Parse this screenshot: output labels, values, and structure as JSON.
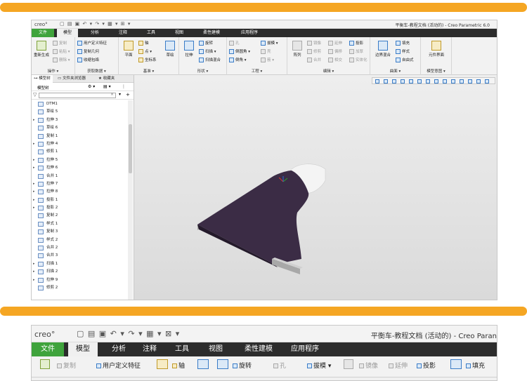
{
  "colors": {
    "accent_bar": "#f5a623",
    "file_tab": "#3fa33c",
    "tab_bar": "#2c2c2c",
    "model_fill": "#3b2c45"
  },
  "top_window": {
    "app_logo": "creo°",
    "title": "平衡车-教程文档 (活动的) - Creo Parametric 6.0",
    "tabs": [
      "文件",
      "模型",
      "分析",
      "注释",
      "工具",
      "视图",
      "柔性建模",
      "应用程序"
    ],
    "active_tab": "模型",
    "ribbon": {
      "groups": [
        {
          "caption": "操作 ▾",
          "items": [
            "重新生成",
            "复制",
            "粘贴 ▾",
            "删除 ▾"
          ]
        },
        {
          "caption": "获取数据 ▾",
          "items": [
            "用户定义特征",
            "复制几何",
            "收缩包络"
          ]
        },
        {
          "caption": "基准 ▾",
          "items": [
            "平面",
            "轴",
            "点 ▾",
            "坐标系",
            "草绘"
          ]
        },
        {
          "caption": "形状 ▾",
          "items": [
            "拉伸",
            "旋转",
            "扫描 ▾",
            "扫描混合"
          ]
        },
        {
          "caption": "工程 ▾",
          "items": [
            "孔",
            "倒圆角 ▾",
            "倒角 ▾",
            "拔模 ▾",
            "壳",
            "筋 ▾"
          ]
        },
        {
          "caption": "编辑 ▾",
          "items": [
            "阵列",
            "镜像",
            "修剪",
            "合并",
            "延伸",
            "偏移",
            "相交",
            "投影",
            "加厚",
            "实体化"
          ]
        },
        {
          "caption": "曲面 ▾",
          "items": [
            "边界混合",
            "填充",
            "样式",
            "自由式"
          ]
        },
        {
          "caption": "模型意图 ▾",
          "items": [
            "元件界面"
          ]
        }
      ]
    },
    "left_panel": {
      "tabs": [
        "模型树",
        "文件夹浏览器",
        "收藏夹"
      ],
      "header": "模型树",
      "tree_items": [
        {
          "label": "DTM1",
          "expandable": false
        },
        {
          "label": "草绘 5",
          "expandable": false
        },
        {
          "label": "拉伸 3",
          "expandable": true
        },
        {
          "label": "草绘 6",
          "expandable": false
        },
        {
          "label": "复制 1",
          "expandable": false
        },
        {
          "label": "拉伸 4",
          "expandable": true
        },
        {
          "label": "修剪 1",
          "expandable": false
        },
        {
          "label": "拉伸 5",
          "expandable": true
        },
        {
          "label": "拉伸 6",
          "expandable": true
        },
        {
          "label": "合并 1",
          "expandable": false
        },
        {
          "label": "拉伸 7",
          "expandable": true
        },
        {
          "label": "拉伸 8",
          "expandable": true
        },
        {
          "label": "投影 1",
          "expandable": true
        },
        {
          "label": "投影 2",
          "expandable": true
        },
        {
          "label": "复制 2",
          "expandable": false
        },
        {
          "label": "样式 1",
          "expandable": false
        },
        {
          "label": "复制 3",
          "expandable": false
        },
        {
          "label": "样式 2",
          "expandable": false
        },
        {
          "label": "合并 2",
          "expandable": false
        },
        {
          "label": "合并 3",
          "expandable": false
        },
        {
          "label": "扫描 1",
          "expandable": true
        },
        {
          "label": "扫描 2",
          "expandable": true
        },
        {
          "label": "拉伸 9",
          "expandable": true
        },
        {
          "label": "修剪 2",
          "expandable": false
        }
      ]
    }
  },
  "bottom_window": {
    "app_logo": "creo°",
    "title": "平衡车-教程文档 (活动的) - Creo Paran",
    "tabs": [
      "文件",
      "模型",
      "分析",
      "注释",
      "工具",
      "视图",
      "柔性建模",
      "应用程序"
    ],
    "active_tab": "模型",
    "ribbon_items": [
      "复制",
      "用户定义特征",
      "轴",
      "旋转",
      "孔",
      "拔模",
      "镜像",
      "延伸",
      "投影",
      "填充"
    ]
  }
}
